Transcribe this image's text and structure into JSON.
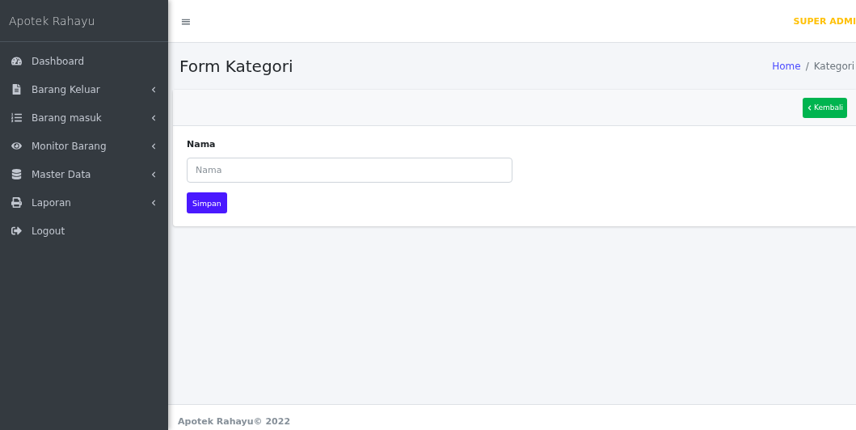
{
  "sidebar": {
    "brand": "Apotek Rahayu",
    "items": [
      {
        "label": "Dashboard",
        "has_submenu": false
      },
      {
        "label": "Barang Keluar",
        "has_submenu": true
      },
      {
        "label": "Barang masuk",
        "has_submenu": true
      },
      {
        "label": "Monitor Barang",
        "has_submenu": true
      },
      {
        "label": "Master Data",
        "has_submenu": true
      },
      {
        "label": "Laporan",
        "has_submenu": true
      },
      {
        "label": "Logout",
        "has_submenu": false
      }
    ]
  },
  "topbar": {
    "menu_icon": "≡",
    "user": "SUPER ADMI"
  },
  "header": {
    "title": "Form Kategori",
    "breadcrumb": [
      "Home",
      "Kategori"
    ],
    "breadcrumb_separator": "/"
  },
  "card": {
    "back_button": "Kembali",
    "field": {
      "label": "Nama",
      "placeholder": "Nama"
    },
    "submit_button": "Simpan"
  },
  "footer": {
    "text": "Apotek Rahayu© 2022"
  }
}
